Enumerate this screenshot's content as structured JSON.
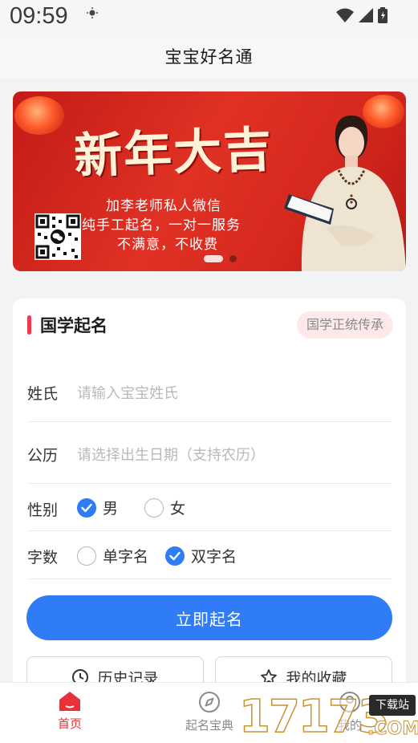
{
  "status_bar": {
    "time": "09:59"
  },
  "app": {
    "title": "宝宝好名通"
  },
  "banner": {
    "headline": "新年大吉",
    "lines": [
      "加李老师私人微信",
      "纯手工起名，一对一服务",
      "不满意，不收费"
    ]
  },
  "form": {
    "title": "国学起名",
    "tag": "国学正统传承",
    "surname": {
      "label": "姓氏",
      "placeholder": "请输入宝宝姓氏"
    },
    "birthday": {
      "label": "公历",
      "placeholder": "请选择出生日期（支持农历）"
    },
    "gender": {
      "label": "性别",
      "options": [
        {
          "label": "男",
          "checked": true
        },
        {
          "label": "女",
          "checked": false
        }
      ]
    },
    "name_length": {
      "label": "字数",
      "options": [
        {
          "label": "单字名",
          "checked": false
        },
        {
          "label": "双字名",
          "checked": true
        }
      ]
    },
    "submit_label": "立即起名",
    "history_label": "历史记录",
    "favorites_label": "我的收藏"
  },
  "tabbar": {
    "items": [
      {
        "label": "首页",
        "icon": "home-icon",
        "active": true
      },
      {
        "label": "起名宝典",
        "icon": "compass-icon",
        "active": false
      },
      {
        "label": "我的",
        "icon": "user-icon",
        "active": false
      }
    ]
  },
  "watermark": {
    "number": "17173",
    "badge": "下载站",
    "domain": ".COM"
  },
  "colors": {
    "primary": "#2f7cf6",
    "accent": "#f0384a",
    "tab_active": "#e8323a"
  }
}
